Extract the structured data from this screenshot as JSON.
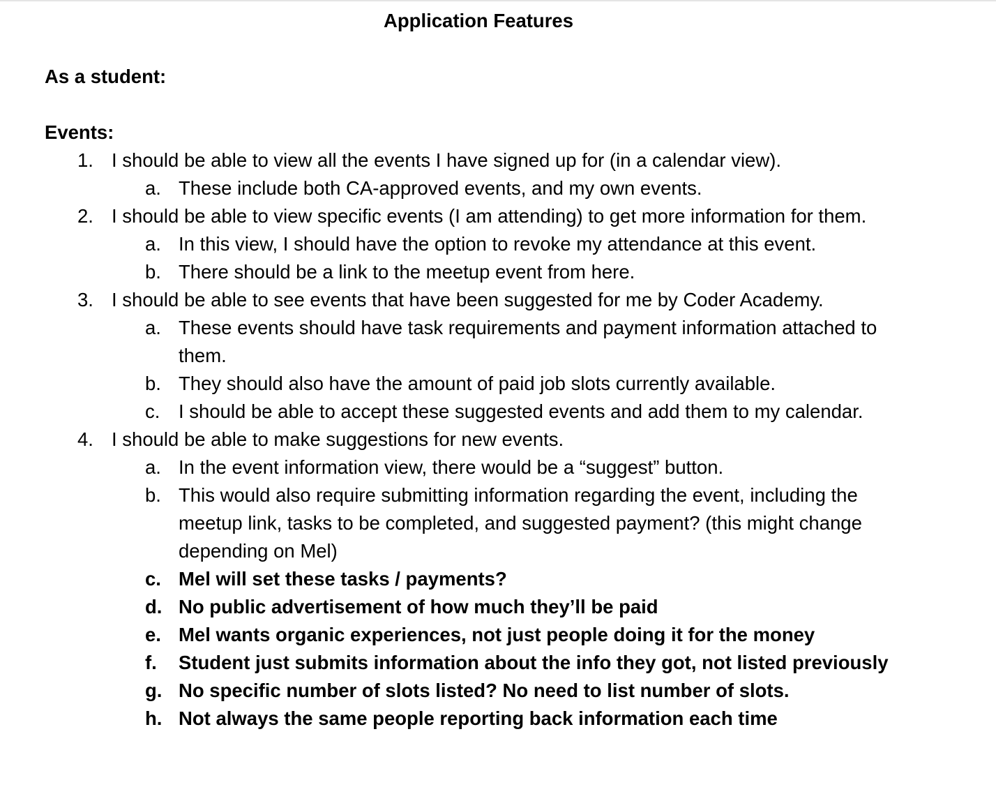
{
  "document": {
    "title": "Application Features",
    "role_heading": "As a student:",
    "section_heading": "Events:"
  },
  "items": [
    {
      "marker": "1.",
      "text": "I should be able to view all the events I have signed up for (in a calendar view).",
      "subitems": [
        {
          "marker": "a.",
          "text": "These include both CA-approved events, and my own events."
        }
      ]
    },
    {
      "marker": "2.",
      "text": "I should be able to view specific events (I am attending) to get more information for them.",
      "subitems": [
        {
          "marker": "a.",
          "text": "In this view, I should have the option to revoke my attendance at this event."
        },
        {
          "marker": "b.",
          "text": "There should be a link to the meetup event from here."
        }
      ]
    },
    {
      "marker": "3.",
      "text": "I should be able to see events that have been suggested for me by Coder Academy.",
      "subitems": [
        {
          "marker": "a.",
          "text": "These events should have task requirements and payment information attached to them."
        },
        {
          "marker": "b.",
          "text": "They should also have the amount of paid job slots currently available."
        },
        {
          "marker": "c.",
          "text": "I should be able to accept these suggested events and add them to my calendar."
        }
      ]
    },
    {
      "marker": "4.",
      "text": "I should be able to make suggestions for new events.",
      "subitems": [
        {
          "marker": "a.",
          "text": "In the event information view, there would be a “suggest” button."
        },
        {
          "marker": "b.",
          "text": "This would also require submitting information regarding the event, including the meetup link, tasks to be completed, and suggested payment? (this might change depending on Mel)"
        },
        {
          "marker": "c.",
          "text": "Mel will set these tasks / payments?"
        },
        {
          "marker": "d.",
          "text": "No public advertisement of how much they’ll be paid"
        },
        {
          "marker": "e.",
          "text": "Mel wants organic experiences, not just people doing it for the money"
        },
        {
          "marker": "f.",
          "text": "Student just submits information about the info they got, not listed previously"
        },
        {
          "marker": "g.",
          "text": "No specific number of slots listed? No need to list number of slots."
        },
        {
          "marker": "h.",
          "text": "Not always the same people reporting back information each time"
        }
      ]
    }
  ]
}
